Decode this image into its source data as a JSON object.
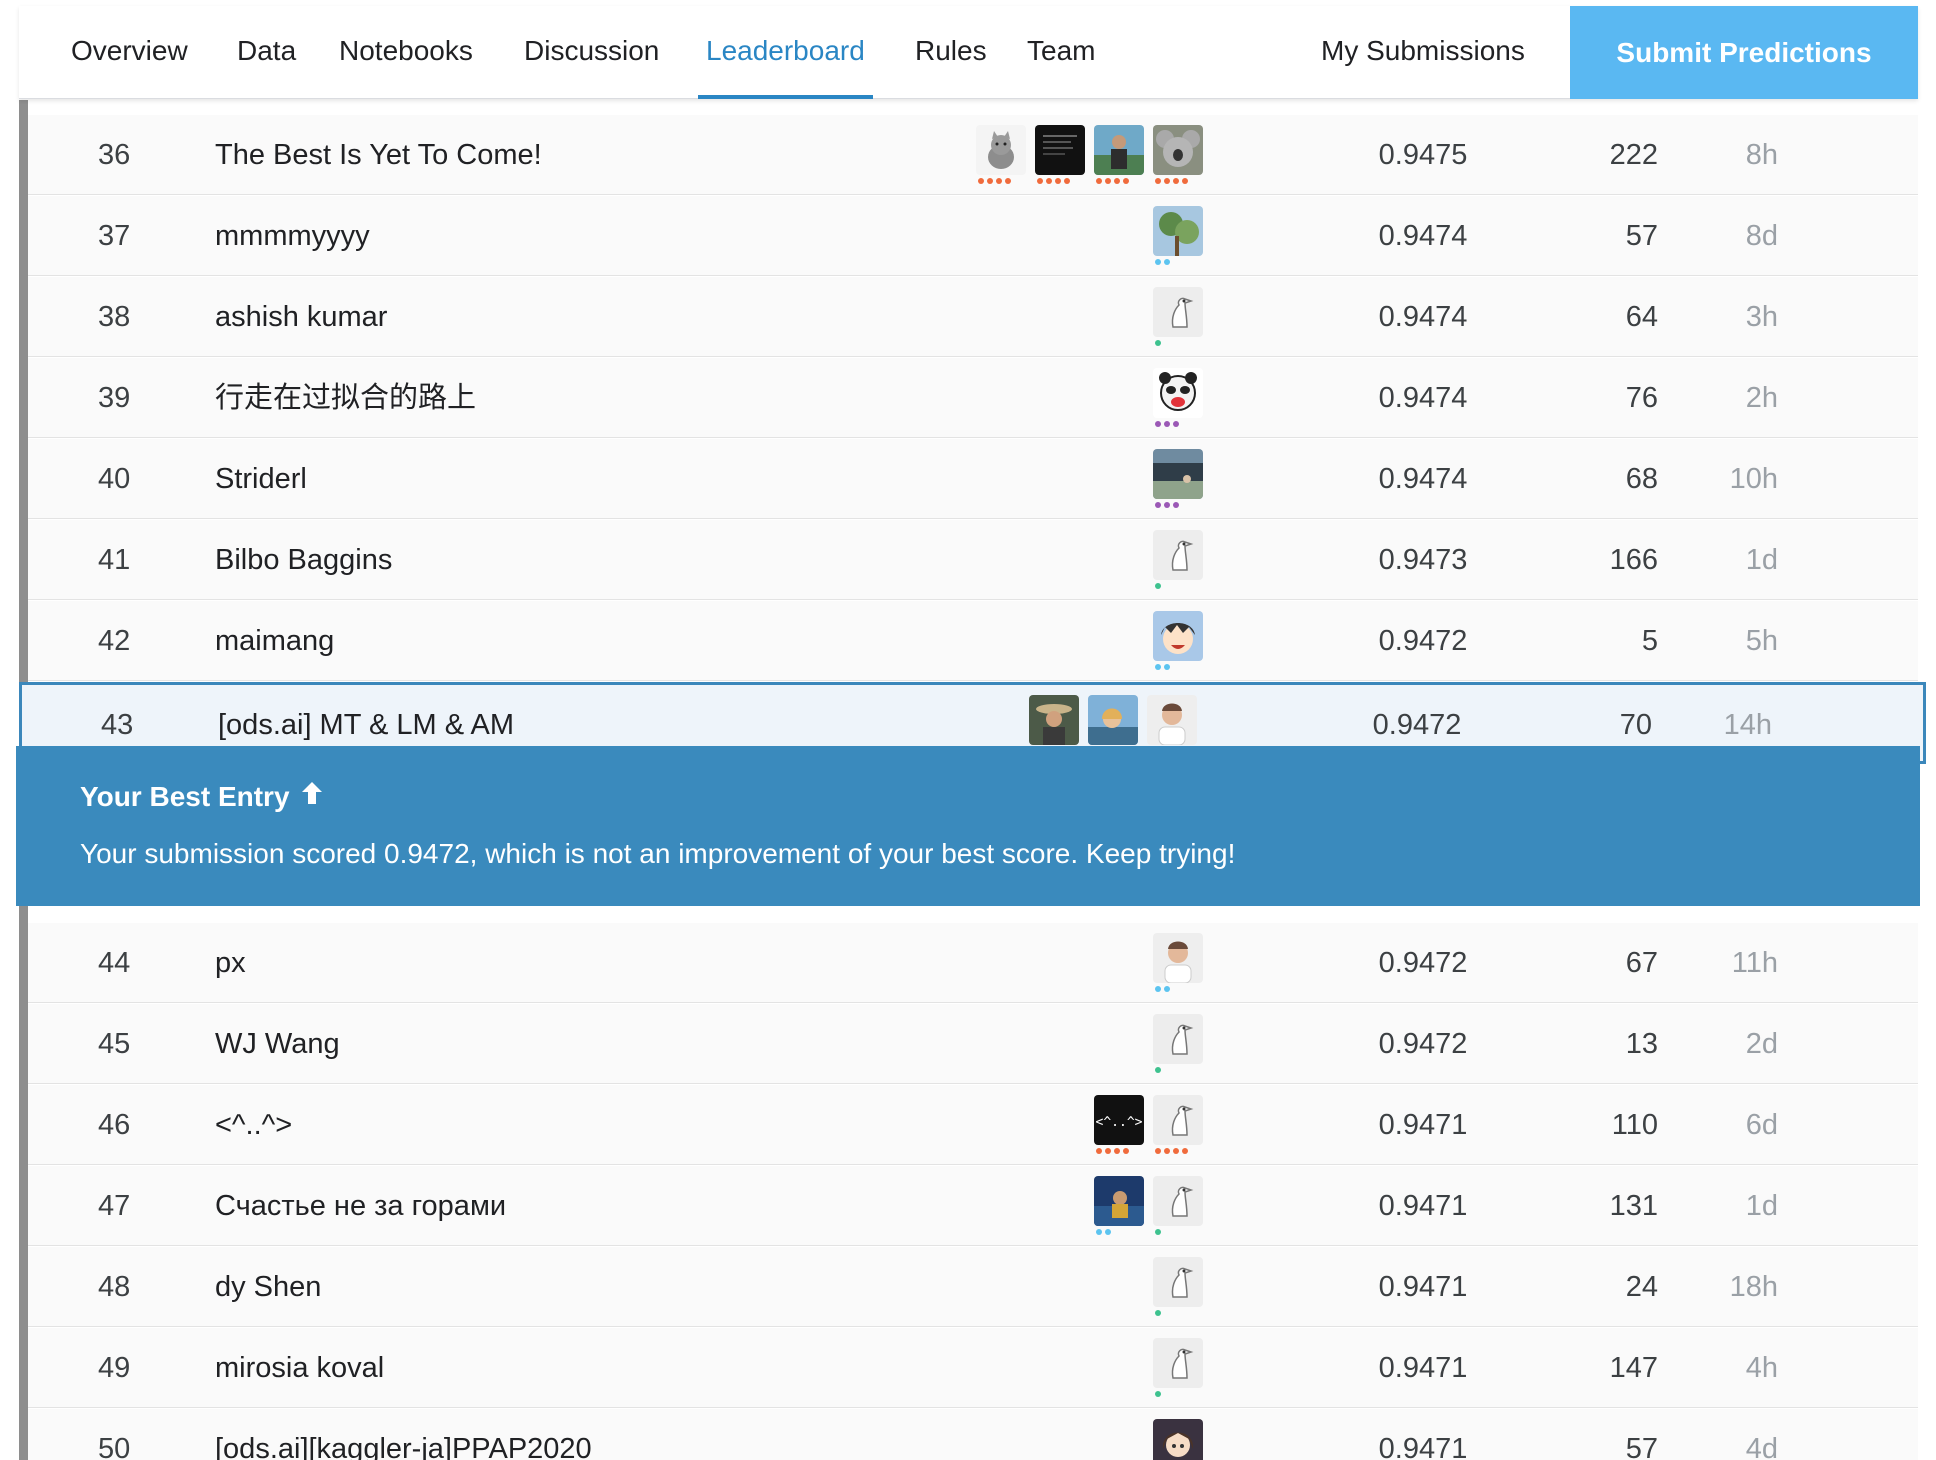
{
  "nav": {
    "tabs": [
      {
        "label": "Overview",
        "active": false
      },
      {
        "label": "Data",
        "active": false
      },
      {
        "label": "Notebooks",
        "active": false
      },
      {
        "label": "Discussion",
        "active": false
      },
      {
        "label": "Leaderboard",
        "active": true
      },
      {
        "label": "Rules",
        "active": false
      },
      {
        "label": "Team",
        "active": false
      }
    ],
    "my_submissions": "My Submissions",
    "submit_predictions": "Submit Predictions"
  },
  "colors": {
    "accent": "#2a86c4",
    "submit_button": "#5ab8f2",
    "banner": "#3a8abd",
    "highlight_row": "#eef4fa",
    "tier_contributor": "#5cc4f0",
    "tier_novice": "#3ec28f",
    "tier_expert": "#9b59b6",
    "tier_master": "#f06b3c"
  },
  "rows": [
    {
      "rank": "36",
      "team": "The Best Is Yet To Come!",
      "score": "0.9475",
      "entries": "222",
      "last": "8h",
      "avatars": [
        {
          "icon": "cat-avatar-icon",
          "tier": "master"
        },
        {
          "icon": "dark-screenshot-avatar-icon",
          "tier": "master"
        },
        {
          "icon": "person-photo-avatar-icon",
          "tier": "master"
        },
        {
          "icon": "koala-avatar-icon",
          "tier": "master"
        }
      ]
    },
    {
      "rank": "37",
      "team": "mmmmyyyy",
      "score": "0.9474",
      "entries": "57",
      "last": "8d",
      "avatars": [
        {
          "icon": "tree-photo-avatar-icon",
          "tier": "contributor"
        }
      ]
    },
    {
      "rank": "38",
      "team": "ashish kumar",
      "score": "0.9474",
      "entries": "64",
      "last": "3h",
      "avatars": [
        {
          "icon": "default-goose-avatar-icon",
          "tier": "novice"
        }
      ]
    },
    {
      "rank": "39",
      "team": "行走在过拟合的路上",
      "score": "0.9474",
      "entries": "76",
      "last": "2h",
      "avatars": [
        {
          "icon": "panda-avatar-icon",
          "tier": "expert"
        }
      ]
    },
    {
      "rank": "40",
      "team": "Striderl",
      "score": "0.9474",
      "entries": "68",
      "last": "10h",
      "avatars": [
        {
          "icon": "building-photo-avatar-icon",
          "tier": "expert"
        }
      ]
    },
    {
      "rank": "41",
      "team": "Bilbo Baggins",
      "score": "0.9473",
      "entries": "166",
      "last": "1d",
      "avatars": [
        {
          "icon": "default-goose-avatar-icon",
          "tier": "novice"
        }
      ]
    },
    {
      "rank": "42",
      "team": "maimang",
      "score": "0.9472",
      "entries": "5",
      "last": "5h",
      "avatars": [
        {
          "icon": "anime-avatar-icon",
          "tier": "contributor"
        }
      ]
    },
    {
      "rank": "43",
      "team": "[ods.ai] MT & LM & AM",
      "score": "0.9472",
      "entries": "70",
      "last": "14h",
      "me": true,
      "avatars": [
        {
          "icon": "person-hat-avatar-icon",
          "tier": "contributor"
        },
        {
          "icon": "person-lake-avatar-icon",
          "tier": "novice"
        },
        {
          "icon": "person-portrait-avatar-icon",
          "tier": "contributor"
        }
      ]
    },
    {
      "rank": "44",
      "team": "px",
      "score": "0.9472",
      "entries": "67",
      "last": "11h",
      "avatars": [
        {
          "icon": "person-portrait-avatar-icon",
          "tier": "contributor"
        }
      ]
    },
    {
      "rank": "45",
      "team": "WJ Wang",
      "score": "0.9472",
      "entries": "13",
      "last": "2d",
      "avatars": [
        {
          "icon": "default-goose-avatar-icon",
          "tier": "novice"
        }
      ]
    },
    {
      "rank": "46",
      "team": "<^..^>",
      "score": "0.9471",
      "entries": "110",
      "last": "6d",
      "avatars": [
        {
          "icon": "cat-face-text-avatar-icon",
          "tier": "master"
        },
        {
          "icon": "default-goose-avatar-icon",
          "tier": "master"
        }
      ]
    },
    {
      "rank": "47",
      "team": "Счастье не за горами",
      "score": "0.9471",
      "entries": "131",
      "last": "1d",
      "avatars": [
        {
          "icon": "person-night-avatar-icon",
          "tier": "contributor"
        },
        {
          "icon": "default-goose-avatar-icon",
          "tier": "novice"
        }
      ]
    },
    {
      "rank": "48",
      "team": "dy Shen",
      "score": "0.9471",
      "entries": "24",
      "last": "18h",
      "avatars": [
        {
          "icon": "default-goose-avatar-icon",
          "tier": "novice"
        }
      ]
    },
    {
      "rank": "49",
      "team": "mirosia koval",
      "score": "0.9471",
      "entries": "147",
      "last": "4h",
      "avatars": [
        {
          "icon": "default-goose-avatar-icon",
          "tier": "novice"
        }
      ]
    },
    {
      "rank": "50",
      "team": "[ods.ai][kaggler-ja]PPAP2020",
      "score": "0.9471",
      "entries": "57",
      "last": "4d",
      "avatars": [
        {
          "icon": "anime-girl-avatar-icon",
          "tier": "expert"
        }
      ]
    }
  ],
  "banner": {
    "title": "Your Best Entry",
    "arrow_icon": "arrow-up-icon",
    "message": "Your submission scored 0.9472, which is not an improvement of your best score. Keep trying!"
  }
}
